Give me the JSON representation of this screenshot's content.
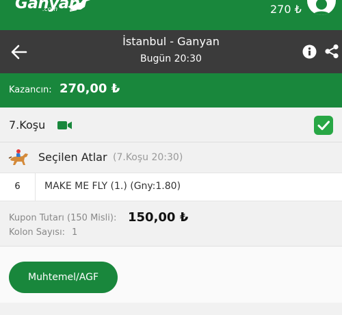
{
  "topbar": {
    "logo_text": "Ganyan",
    "logo_sub": ".com",
    "balance": "270 ₺"
  },
  "header": {
    "title": "İstanbul - Ganyan",
    "subtitle": "Bugün 20:30"
  },
  "winnings": {
    "label": "Kazancın:",
    "value": "270,00 ₺"
  },
  "race": {
    "title": "7.Koşu"
  },
  "selection": {
    "title": "Seçilen Atlar",
    "meta": "(7.Koşu 20:30)",
    "horses": [
      {
        "number": "6",
        "name": "MAKE ME FLY (1.) (Gny:1.80)"
      }
    ]
  },
  "summary": {
    "coupon_label": "Kupon Tutarı (150 Misli):",
    "coupon_value": "150,00 ₺",
    "columns_label": "Kolon Sayısı:",
    "columns_value": "1"
  },
  "actions": {
    "agf_label": "Muhtemel/AGF"
  },
  "colors": {
    "brand_green": "#19873c",
    "header_dark": "#3b3b3b",
    "check_green": "#28a745"
  }
}
